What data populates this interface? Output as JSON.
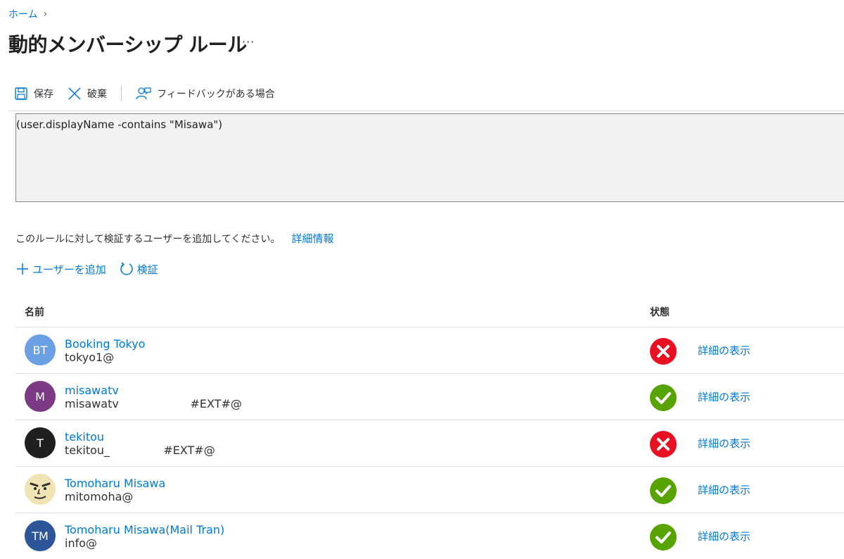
{
  "breadcrumb": {
    "home": "ホーム",
    "separator": "›"
  },
  "page": {
    "title": "動的メンバーシップ ルール",
    "more": "···"
  },
  "toolbar": {
    "save_label": "保存",
    "discard_label": "破棄",
    "feedback_label": "フィードバックがある場合"
  },
  "rule": {
    "expression": "(user.displayName -contains \"Misawa\")"
  },
  "validation": {
    "hint": "このルールに対して検証するユーザーを追加してください。",
    "learn_more": "詳細情報",
    "add_user_label": "ユーザーを追加",
    "validate_label": "検証"
  },
  "table": {
    "columns": {
      "name": "名前",
      "status": "状態"
    },
    "rows": [
      {
        "initials": "BT",
        "name": "Booking Tokyo",
        "email": "tokyo1@",
        "status": "fail",
        "detail": "詳細の表示",
        "avatar_color": "#6ca0e4"
      },
      {
        "initials": "M",
        "name": "misawatv",
        "email": "misawatv                    #EXT#@",
        "status": "pass",
        "detail": "詳細の表示",
        "avatar_color": "#7b3a83"
      },
      {
        "initials": "T",
        "name": "tekitou",
        "email": "tekitou_               #EXT#@",
        "status": "fail",
        "detail": "詳細の表示",
        "avatar_color": "#1f1f1f"
      },
      {
        "initials": "",
        "name": "Tomoharu Misawa",
        "email": "mitomoha@",
        "status": "pass",
        "detail": "詳細の表示",
        "avatar_color": "#f0e3b4"
      },
      {
        "initials": "TM",
        "name": "Tomoharu Misawa(Mail Tran)",
        "email": "info@",
        "status": "pass",
        "detail": "詳細の表示",
        "avatar_color": "#2c5697"
      }
    ]
  },
  "colors": {
    "accent": "#0078d4",
    "pass": "#57a300",
    "fail": "#e81123"
  },
  "icons": {
    "save": "save-icon",
    "discard": "close-icon",
    "feedback": "feedback-icon",
    "add": "plus-icon",
    "validate": "refresh-icon"
  }
}
